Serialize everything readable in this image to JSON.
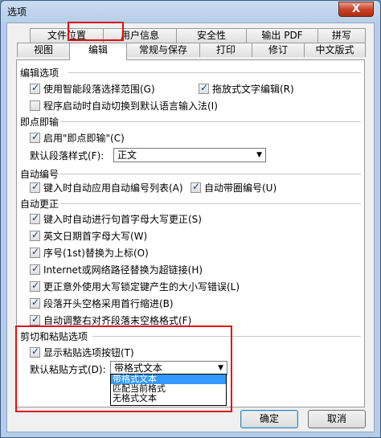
{
  "window": {
    "title": "选项",
    "close_label": "X"
  },
  "tabs": {
    "back": [
      {
        "label": "文件位置"
      },
      {
        "label": "用户信息"
      },
      {
        "label": "安全性"
      },
      {
        "label": "输出 PDF"
      },
      {
        "label": "拼写"
      }
    ],
    "front": [
      {
        "label": "视图"
      },
      {
        "label": "编辑"
      },
      {
        "label": "常规与保存"
      },
      {
        "label": "打印"
      },
      {
        "label": "修订"
      },
      {
        "label": "中文版式"
      }
    ],
    "active": "编辑"
  },
  "sections": {
    "edit": {
      "title": "编辑选项",
      "smart_select": "使用智能段落选择范围(G)",
      "drag_drop": "拖放式文字编辑(R)",
      "auto_ime": "程序启动时自动切换到默认语言输入法(I)"
    },
    "click_type": {
      "title": "即点即输",
      "enable": "启用\"即点即输\"(C)",
      "default_style_label": "默认段落样式(F):",
      "default_style_value": "正文"
    },
    "auto_number": {
      "title": "自动编号",
      "auto_list": "键入时自动应用自动编号列表(A)",
      "circle_number": "自动带圈编号(U)"
    },
    "auto_correct": {
      "title": "自动更正",
      "items": [
        "键入时自动进行句首字母大写更正(S)",
        "英文日期首字母大写(W)",
        "序号(1st)替换为上标(O)",
        "Internet或网络路径替换为超链接(H)",
        "更正意外使用大写锁定键产生的大小写错误(L)",
        "段落开头空格采用首行缩进(B)",
        "自动调整右对齐段落末空格格式(F)"
      ]
    },
    "cut_paste": {
      "title": "剪切和粘贴选项",
      "show_button": "显示粘贴选项按钮(T)",
      "default_paste_label": "默认粘贴方式(D):",
      "default_paste_value": "带格式文本",
      "options": [
        "带格式文本",
        "匹配当前格式",
        "无格式文本"
      ]
    }
  },
  "buttons": {
    "ok": "确定",
    "cancel": "取消"
  },
  "colors": {
    "highlight": "#e01010",
    "selection": "#3399ff"
  }
}
